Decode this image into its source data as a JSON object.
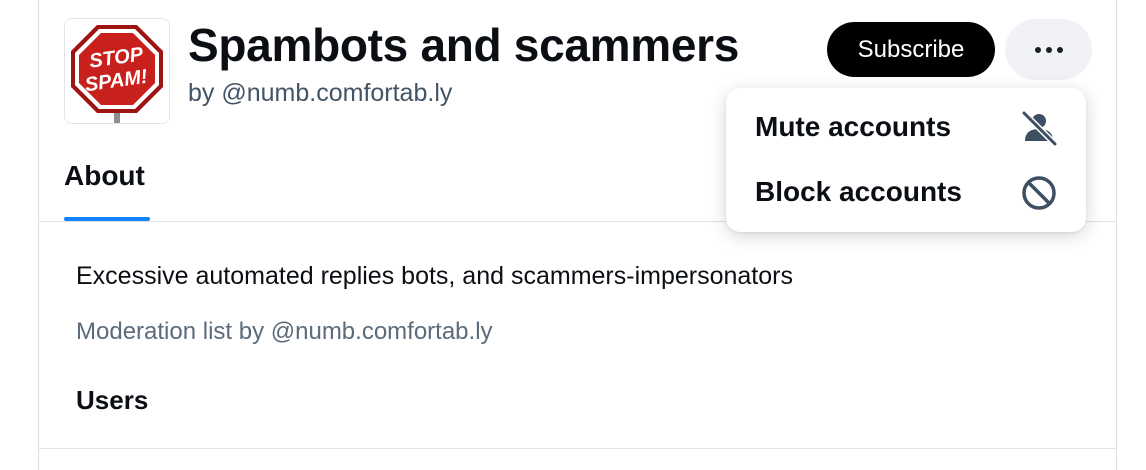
{
  "list": {
    "title": "Spambots and scammers",
    "byline": "by @numb.comfortab.ly",
    "avatar": {
      "line1": "STOP",
      "line2": "SPAM!",
      "icon": "stop-sign-icon",
      "color": "#c8201d"
    }
  },
  "header": {
    "subscribe_label": "Subscribe",
    "more_icon": "ellipsis-icon"
  },
  "tabs": [
    {
      "label": "About",
      "active": true
    }
  ],
  "about": {
    "description": "Excessive automated replies bots, and scammers-impersonators",
    "moderation": "Moderation list by @numb.comfortab.ly",
    "users_heading": "Users"
  },
  "menu": {
    "items": [
      {
        "label": "Mute accounts",
        "icon": "person-muted-icon"
      },
      {
        "label": "Block accounts",
        "icon": "block-icon"
      }
    ]
  },
  "colors": {
    "accent": "#1083fe",
    "button_dark": "#000000",
    "text_muted": "#5b6b7c"
  }
}
